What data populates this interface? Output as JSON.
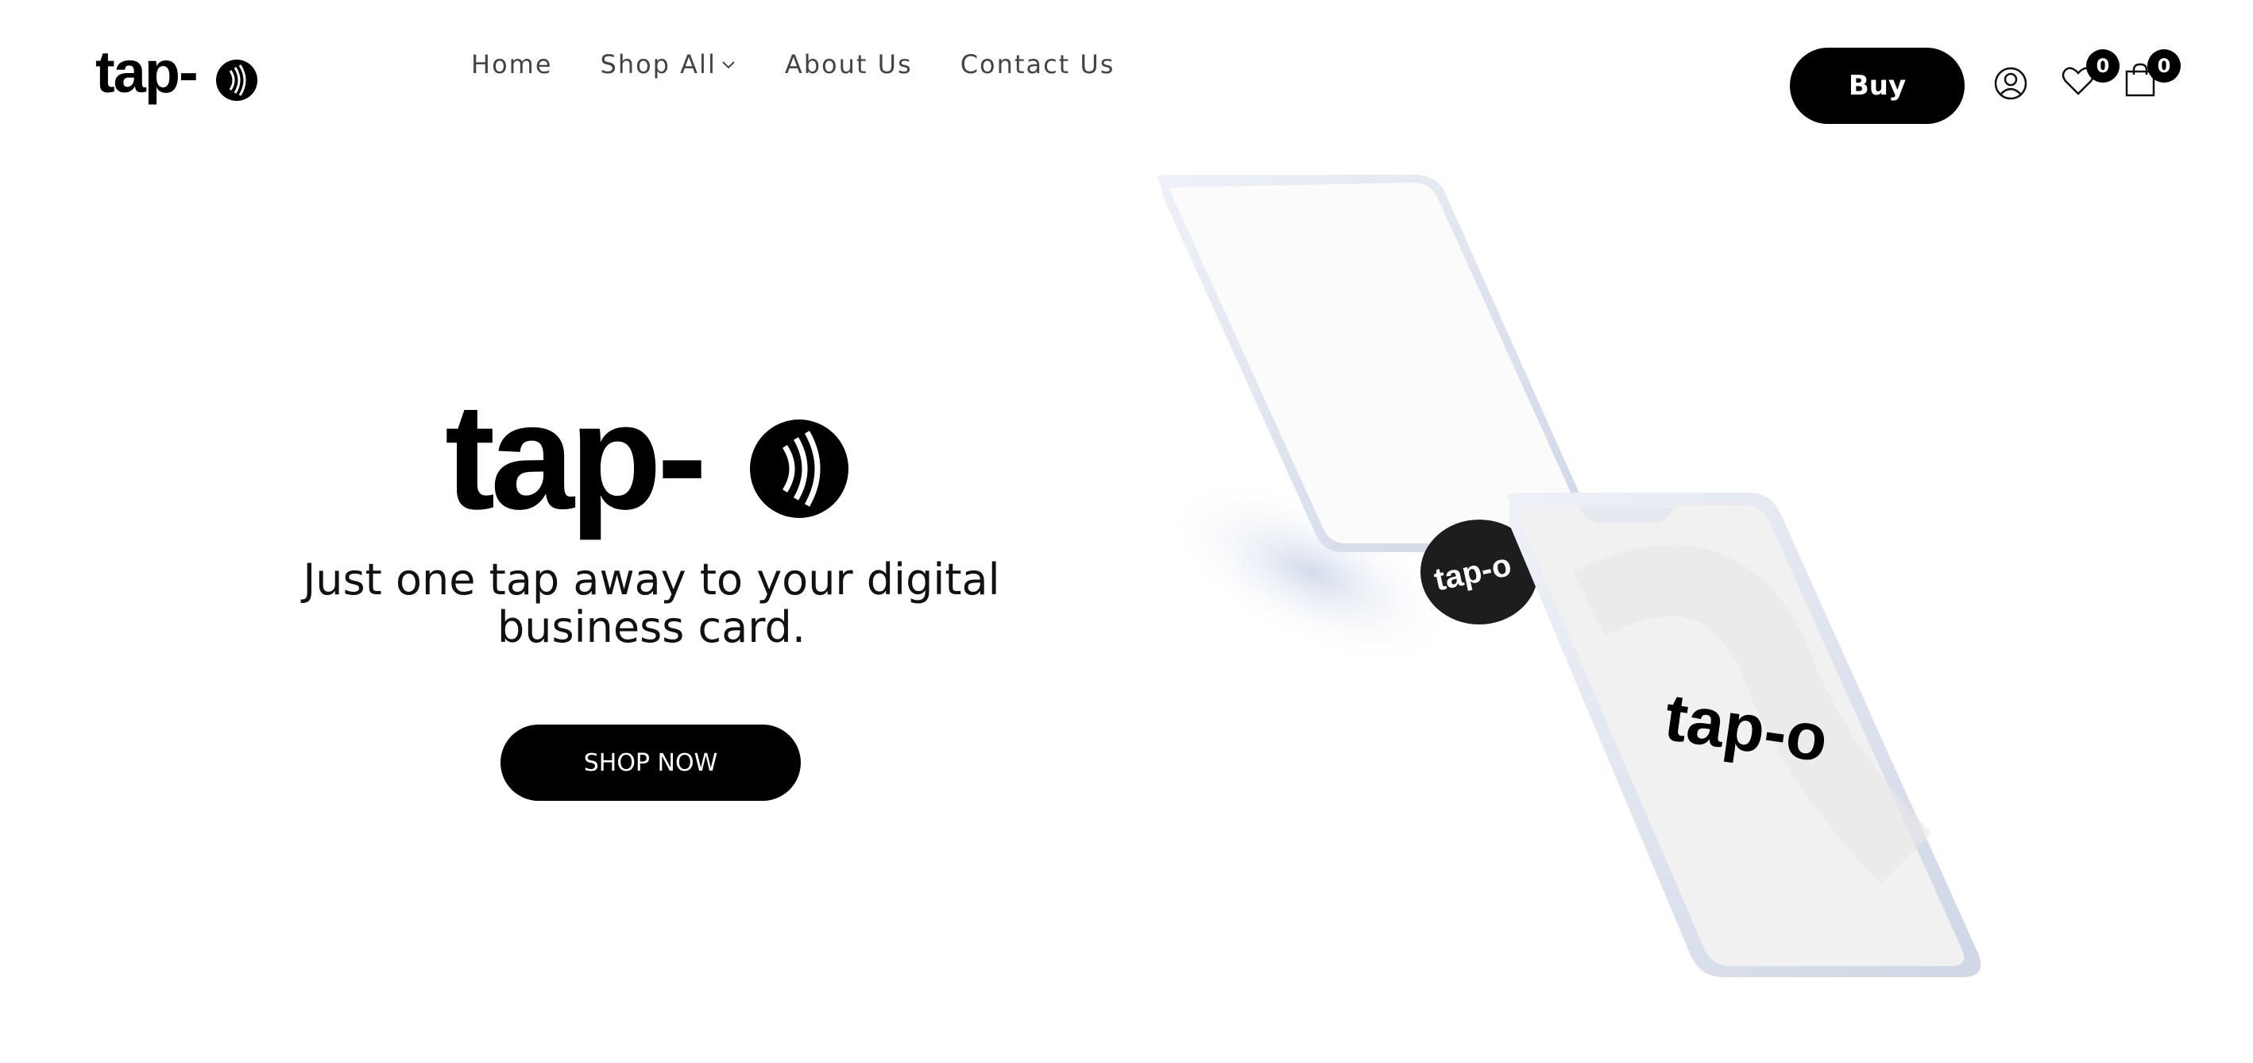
{
  "header": {
    "logo_text": "tap-o",
    "nav": [
      {
        "label": "Home",
        "has_dropdown": false
      },
      {
        "label": "Shop All",
        "has_dropdown": true
      },
      {
        "label": "About Us",
        "has_dropdown": false
      },
      {
        "label": "Contact Us",
        "has_dropdown": false
      }
    ],
    "buy_label": "Buy",
    "icons": [
      "account-icon",
      "heart-icon",
      "shopping-bag-icon",
      "chevron-down-icon"
    ],
    "wishlist_count": "0",
    "cart_count": "0"
  },
  "hero": {
    "logo_text": "tap-o",
    "tagline": "Just one tap away to your digital business card.",
    "cta_label": "SHOP NOW"
  },
  "phones": {
    "card_logo_text": "tap-o",
    "screen_logo_text": "tap-o"
  },
  "colors": {
    "primary": "#000000",
    "background": "#ffffff",
    "nav_text": "#444444"
  }
}
